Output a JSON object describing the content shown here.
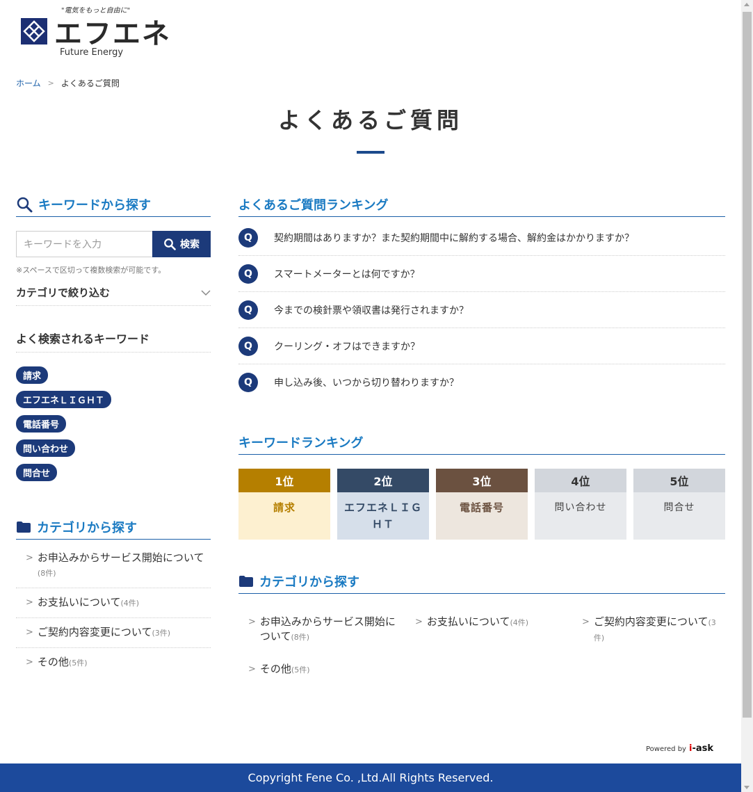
{
  "logo": {
    "tagline": "\"電気をもっと自由に\"",
    "name": "エフエネ",
    "sub": "Future Energy"
  },
  "breadcrumb": {
    "home": "ホーム",
    "current": "よくあるご質問"
  },
  "page_title": "よくあるご質問",
  "sidebar": {
    "keyword_heading": "キーワードから探す",
    "search_placeholder": "キーワードを入力",
    "search_button": "検索",
    "search_note": "※スペースで区切って複数検索が可能です。",
    "filter_label": "カテゴリで絞り込む",
    "popular_heading": "よく検索されるキーワード",
    "tags": [
      "請求",
      "エフエネＬＩＧＨＴ",
      "電話番号",
      "問い合わせ",
      "問合せ"
    ],
    "category_heading": "カテゴリから探す",
    "categories": [
      {
        "label": "お申込みからサービス開始について",
        "count": "(8件)"
      },
      {
        "label": "お支払いについて",
        "count": "(4件)"
      },
      {
        "label": "ご契約内容変更について",
        "count": "(3件)"
      },
      {
        "label": "その他",
        "count": "(5件)"
      }
    ]
  },
  "main": {
    "ranking_heading": "よくあるご質問ランキング",
    "q_badge": "Q",
    "faqs": [
      "契約期間はありますか？また契約期間中に解約する場合、解約金はかかりますか？",
      "スマートメーターとは何ですか？",
      "今までの検針票や領収書は発行されますか？",
      "クーリング・オフはできますか？",
      "申し込み後、いつから切り替わりますか？"
    ],
    "keyword_ranking_heading": "キーワードランキング",
    "keyword_ranking": [
      {
        "rank": "1位",
        "word": "請求",
        "rank_bg": "#b57f00",
        "word_bg": "#fdf0d0",
        "word_color": "#b57f00"
      },
      {
        "rank": "2位",
        "word": "エフエネＬＩＧＨＴ",
        "rank_bg": "#344a66",
        "word_bg": "#d6dfea",
        "word_color": "#344a66"
      },
      {
        "rank": "3位",
        "word": "電話番号",
        "rank_bg": "#6b5140",
        "word_bg": "#ede6de",
        "word_color": "#6b5140"
      },
      {
        "rank": "4位",
        "word": "問い合わせ",
        "rank_bg": "#d2d6dc",
        "word_bg": "#e8eaed",
        "word_color": "#444444"
      },
      {
        "rank": "5位",
        "word": "問合せ",
        "rank_bg": "#d2d6dc",
        "word_bg": "#e8eaed",
        "word_color": "#444444"
      }
    ],
    "category_heading": "カテゴリから探す",
    "categories": [
      {
        "label": "お申込みからサービス開始について",
        "count": "(8件)"
      },
      {
        "label": "お支払いについて",
        "count": "(4件)"
      },
      {
        "label": "ご契約内容変更について",
        "count": "(3件)"
      },
      {
        "label": "その他",
        "count": "(5件)"
      }
    ]
  },
  "powered": {
    "prefix": "Powered by",
    "brand_i": "i",
    "brand_rest": "-ask"
  },
  "footer": "Copyright Fene Co. ,Ltd.All Rights Reserved.",
  "colors": {
    "accent": "#1a7ac2",
    "navy": "#1c3a7a",
    "footer": "#1c4a9c"
  },
  "icons": [
    "search-icon",
    "folder-icon",
    "chevron-down-icon",
    "chevron-right-icon"
  ]
}
